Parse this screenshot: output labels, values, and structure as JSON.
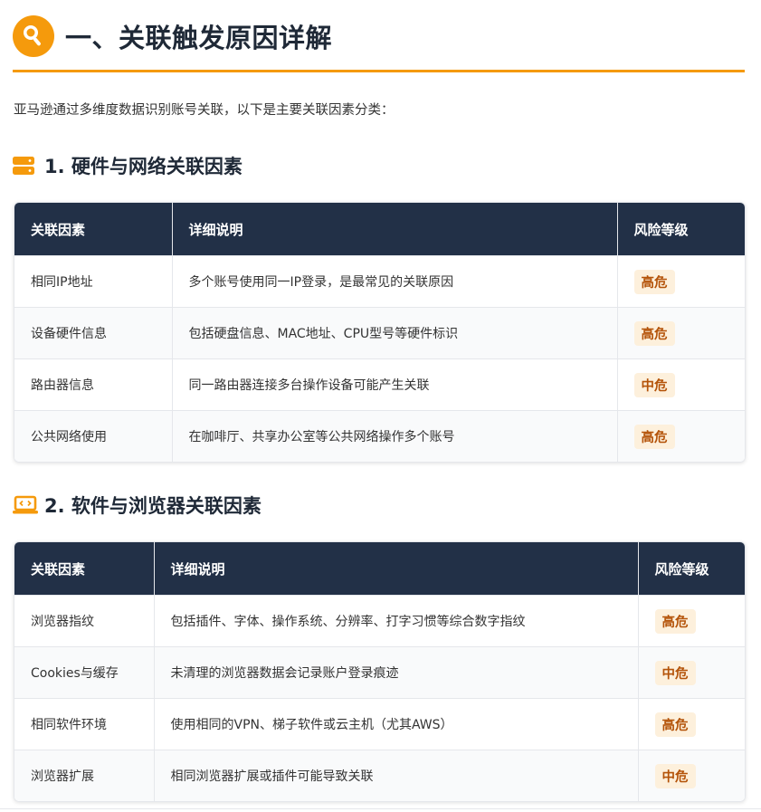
{
  "header": {
    "title": "一、关联触发原因详解",
    "accent_color": "#f59a0c",
    "icon": "search-icon"
  },
  "intro": "亚马逊通过多维度数据识别账号关联，以下是主要关联因素分类：",
  "sections": [
    {
      "icon": "server-icon",
      "title": "1. 硬件与网络关联因素",
      "columns": [
        "关联因素",
        "详细说明",
        "风险等级"
      ],
      "rows": [
        {
          "factor": "相同IP地址",
          "detail": "多个账号使用同一IP登录，是最常见的关联原因",
          "risk": "高危"
        },
        {
          "factor": "设备硬件信息",
          "detail": "包括硬盘信息、MAC地址、CPU型号等硬件标识",
          "risk": "高危"
        },
        {
          "factor": "路由器信息",
          "detail": "同一路由器连接多台操作设备可能产生关联",
          "risk": "中危"
        },
        {
          "factor": "公共网络使用",
          "detail": "在咖啡厅、共享办公室等公共网络操作多个账号",
          "risk": "高危"
        }
      ]
    },
    {
      "icon": "laptop-code-icon",
      "title": "2. 软件与浏览器关联因素",
      "columns": [
        "关联因素",
        "详细说明",
        "风险等级"
      ],
      "rows": [
        {
          "factor": "浏览器指纹",
          "detail": "包括插件、字体、操作系统、分辨率、打字习惯等综合数字指纹",
          "risk": "高危"
        },
        {
          "factor": "Cookies与缓存",
          "detail": "未清理的浏览器数据会记录账户登录痕迹",
          "risk": "中危"
        },
        {
          "factor": "相同软件环境",
          "detail": "使用相同的VPN、梯子软件或云主机（尤其AWS）",
          "risk": "高危"
        },
        {
          "factor": "浏览器扩展",
          "detail": "相同浏览器扩展或插件可能导致关联",
          "risk": "中危"
        }
      ]
    }
  ],
  "colors": {
    "table_header_bg": "#223047",
    "risk_badge_bg": "#fdf0dc",
    "risk_badge_text": "#b45309"
  }
}
